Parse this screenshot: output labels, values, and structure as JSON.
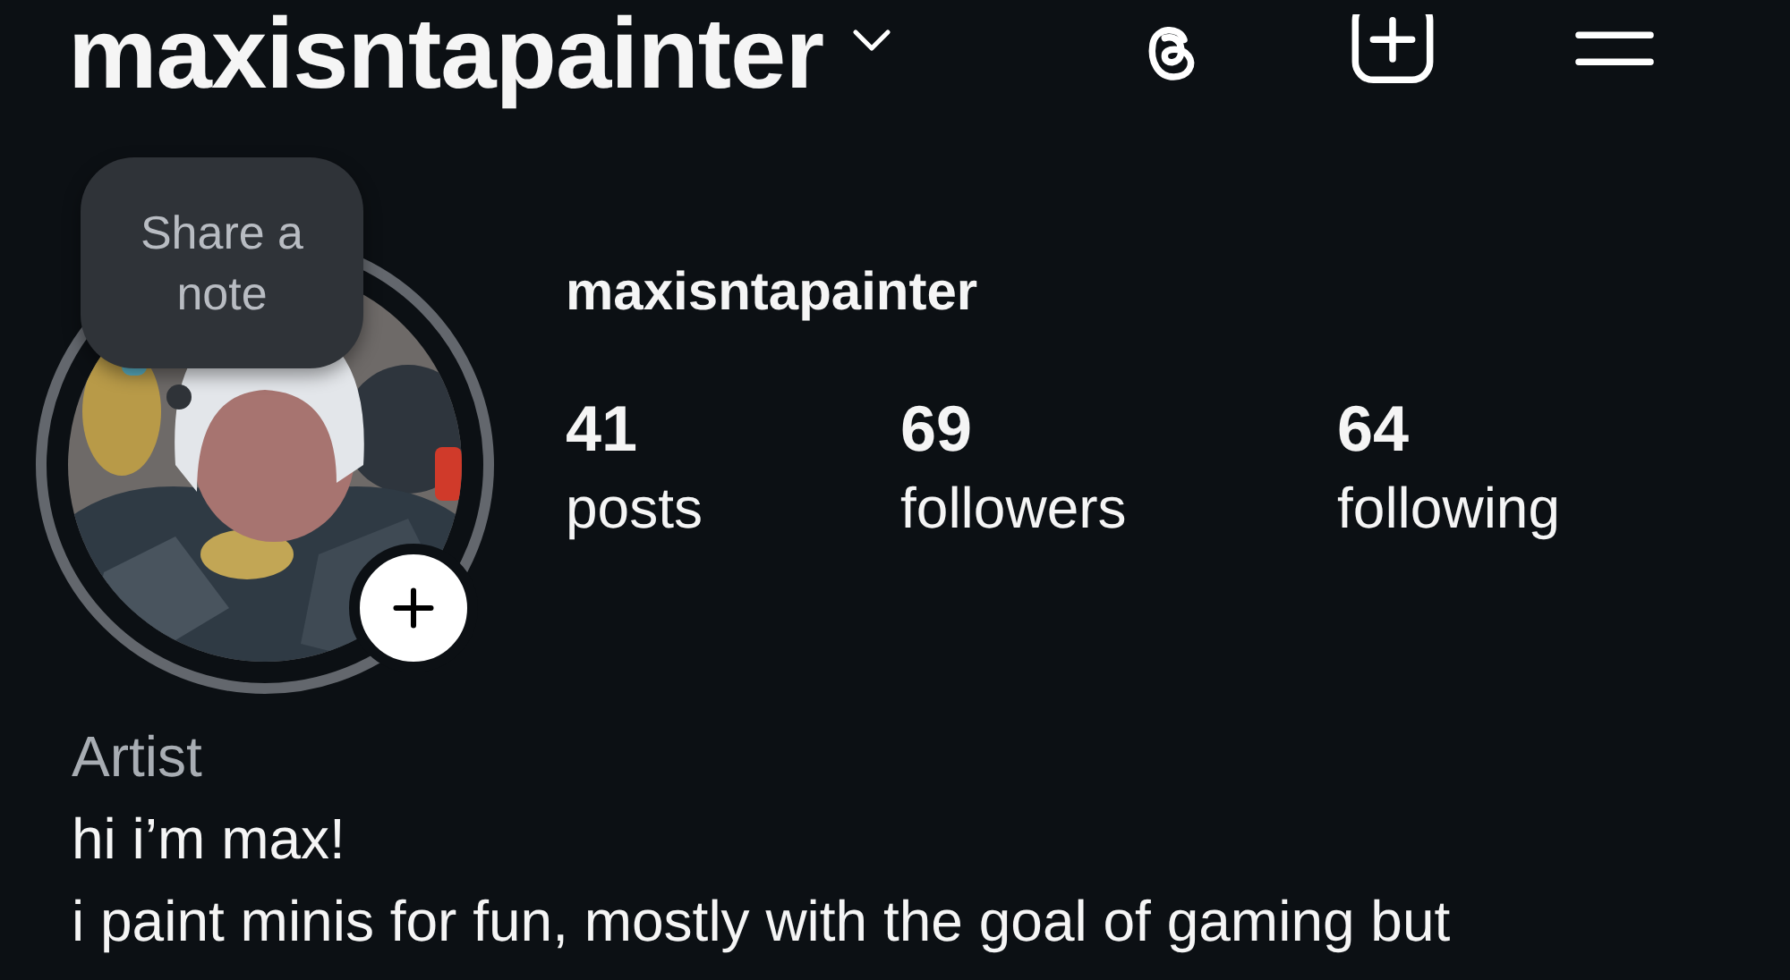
{
  "header": {
    "title": "maxisntapainter"
  },
  "note": {
    "text": "Share a note"
  },
  "profile": {
    "username": "maxisntapainter",
    "stats": [
      {
        "value": "41",
        "label": "posts"
      },
      {
        "value": "69",
        "label": "followers"
      },
      {
        "value": "64",
        "label": "following"
      }
    ]
  },
  "bio": {
    "category": "Artist",
    "lines": [
      "hi i’m max!",
      "i paint minis for fun, mostly with the goal of gaming but"
    ]
  }
}
